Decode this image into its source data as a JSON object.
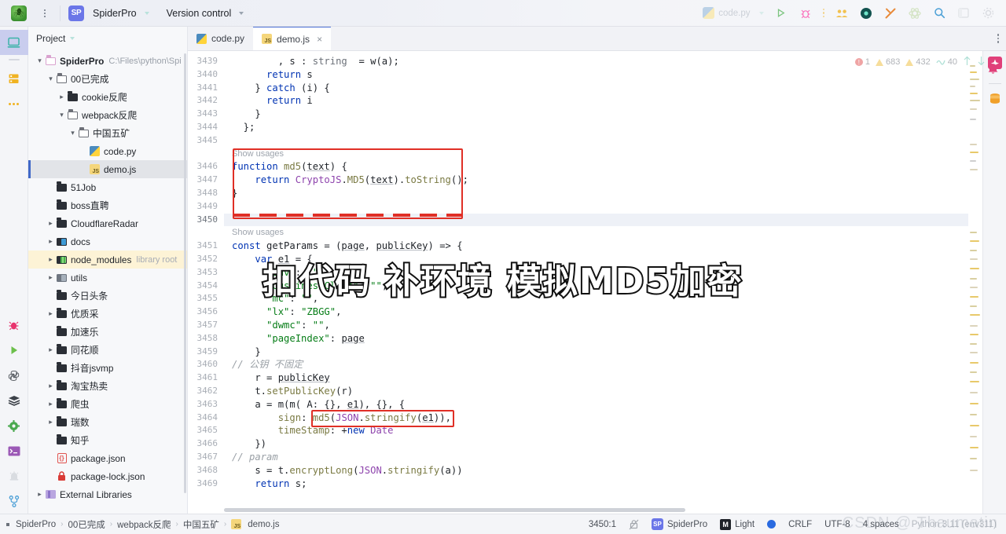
{
  "titlebar": {
    "app_logo_icon": "spider-logo-icon",
    "menu_icon": "main-menu-kebab-icon",
    "project_badge": "SP",
    "project_name": "SpiderPro",
    "vcs_label": "Version control",
    "run_config_label": "code.py",
    "icons": {
      "run": "run-icon",
      "debug": "debug-bug-icon",
      "more": "more-actions-kebab-icon",
      "collab": "code-with-me-icon",
      "ai": "ai-assistant-icon",
      "tools": "build-tools-icon",
      "atom": "science-atom-icon",
      "search": "search-everywhere-icon",
      "panel": "layout-panel-icon",
      "settings": "settings-gear-icon"
    }
  },
  "activitybar": {
    "items": [
      {
        "name": "project-tool-icon",
        "glyph": "monitor",
        "selected": true
      },
      {
        "name": "database-tool-icon",
        "glyph": "database",
        "selected": false
      },
      {
        "name": "more-tool-windows-icon",
        "glyph": "dots",
        "selected": false
      }
    ],
    "bottom_items": [
      {
        "name": "bug-tool-icon",
        "glyph": "bug"
      },
      {
        "name": "run-tool-icon",
        "glyph": "play"
      },
      {
        "name": "python-console-icon",
        "glyph": "python"
      },
      {
        "name": "services-stack-icon",
        "glyph": "stack"
      },
      {
        "name": "settings-gear-icon",
        "glyph": "gear"
      },
      {
        "name": "terminal-icon",
        "glyph": "terminal"
      },
      {
        "name": "problems-alert-icon",
        "glyph": "alert"
      },
      {
        "name": "version-control-branch-icon",
        "glyph": "branch"
      }
    ]
  },
  "project_panel": {
    "title": "Project",
    "tree": [
      {
        "indent": 0,
        "arrow": "down",
        "icon": "folder-pink",
        "label": "SpiderPro",
        "bold": true,
        "sub": "C:\\Files\\python\\Spi"
      },
      {
        "indent": 1,
        "arrow": "down",
        "icon": "folder-open",
        "label": "00已完成"
      },
      {
        "indent": 2,
        "arrow": "right",
        "icon": "folder-dark",
        "label": "cookie反爬"
      },
      {
        "indent": 2,
        "arrow": "down",
        "icon": "folder-open",
        "label": "webpack反爬"
      },
      {
        "indent": 3,
        "arrow": "down",
        "icon": "folder-open",
        "label": "中国五矿"
      },
      {
        "indent": 4,
        "arrow": "none",
        "icon": "python-file",
        "label": "code.py"
      },
      {
        "indent": 4,
        "arrow": "none",
        "icon": "js-file",
        "label": "demo.js",
        "selected": true
      },
      {
        "indent": 1,
        "arrow": "none",
        "icon": "folder-dark",
        "label": "51Job"
      },
      {
        "indent": 1,
        "arrow": "none",
        "icon": "folder-dark",
        "label": "boss直聘"
      },
      {
        "indent": 1,
        "arrow": "right",
        "icon": "folder-dark",
        "label": "CloudflareRadar"
      },
      {
        "indent": 1,
        "arrow": "right",
        "icon": "folder-blue",
        "label": "docs"
      },
      {
        "indent": 1,
        "arrow": "right",
        "icon": "folder-green",
        "label": "node_modules",
        "sub2": "library root",
        "highlight": true
      },
      {
        "indent": 1,
        "arrow": "right",
        "icon": "folder-grey",
        "label": "utils"
      },
      {
        "indent": 1,
        "arrow": "none",
        "icon": "folder-dark",
        "label": "今日头条"
      },
      {
        "indent": 1,
        "arrow": "right",
        "icon": "folder-dark",
        "label": "优质采"
      },
      {
        "indent": 1,
        "arrow": "none",
        "icon": "folder-dark",
        "label": "加速乐"
      },
      {
        "indent": 1,
        "arrow": "right",
        "icon": "folder-dark",
        "label": "同花顺"
      },
      {
        "indent": 1,
        "arrow": "none",
        "icon": "folder-dark",
        "label": "抖音jsvmp"
      },
      {
        "indent": 1,
        "arrow": "right",
        "icon": "folder-dark",
        "label": "淘宝热卖"
      },
      {
        "indent": 1,
        "arrow": "right",
        "icon": "folder-dark",
        "label": "爬虫"
      },
      {
        "indent": 1,
        "arrow": "right",
        "icon": "folder-dark",
        "label": "瑞数"
      },
      {
        "indent": 1,
        "arrow": "none",
        "icon": "folder-dark",
        "label": "知乎"
      },
      {
        "indent": 1,
        "arrow": "none",
        "icon": "json-file",
        "label": "package.json"
      },
      {
        "indent": 1,
        "arrow": "none",
        "icon": "lock-file",
        "label": "package-lock.json"
      },
      {
        "indent": 0,
        "arrow": "right",
        "icon": "folder-purple",
        "label": "External Libraries"
      }
    ]
  },
  "editor": {
    "tabs": [
      {
        "label": "code.py",
        "icon": "python-file-icon",
        "active": false,
        "closable": false
      },
      {
        "label": "demo.js",
        "icon": "js-file-icon",
        "active": true,
        "closable": true,
        "close_label": "×"
      }
    ],
    "tab_options_icon": "editor-options-kebab-icon",
    "inspection": {
      "errors": "1",
      "warnings": "683",
      "weak_warnings": "432",
      "typos": "40",
      "prev_icon": "previous-highlight-icon",
      "next_icon": "next-highlight-icon",
      "widget_icon": "inspections-widget-icon"
    },
    "first_line_number": 3439,
    "lines": [
      {
        "n": 3439,
        "code": ", s : string  = w(a);"
      },
      {
        "n": 3440,
        "code": "return s"
      },
      {
        "n": 3441,
        "code": "} catch (i) {"
      },
      {
        "n": 3442,
        "code": "return i"
      },
      {
        "n": 3443,
        "code": "}"
      },
      {
        "n": 3444,
        "code": "};"
      },
      {
        "n": 3445,
        "code": ""
      },
      {
        "n": 3446,
        "code": "function md5(text) {",
        "hint": "Show usages"
      },
      {
        "n": 3447,
        "code": "return CryptoJS.MD5(text).toString();"
      },
      {
        "n": 3448,
        "code": "}"
      },
      {
        "n": 3449,
        "code": ""
      },
      {
        "n": 3450,
        "code": "",
        "current": true
      },
      {
        "n": 3451,
        "code": "const getParams = (page, publicKey) => {",
        "hint": "Show usages"
      },
      {
        "n": 3452,
        "code": "var e1 = {"
      },
      {
        "n": 3453,
        "code": "\"inv\": \"\","
      },
      {
        "n": 3454,
        "code": "\"bussinessClass\": \"\","
      },
      {
        "n": 3455,
        "code": "\"mc\": \"\","
      },
      {
        "n": 3456,
        "code": "\"lx\": \"ZBGG\","
      },
      {
        "n": 3457,
        "code": "\"dwmc\": \"\","
      },
      {
        "n": 3458,
        "code": "\"pageIndex\": page"
      },
      {
        "n": 3459,
        "code": "}"
      },
      {
        "n": 3460,
        "code": "// 公钥 不固定"
      },
      {
        "n": 3461,
        "code": "r = publicKey"
      },
      {
        "n": 3462,
        "code": "t.setPublicKey(r)"
      },
      {
        "n": 3463,
        "code": "a = m(m( A: {}, e1), {}, {"
      },
      {
        "n": 3464,
        "code": "sign: md5(JSON.stringify(e1)),"
      },
      {
        "n": 3465,
        "code": "timeStamp: +new Date"
      },
      {
        "n": 3466,
        "code": "})"
      },
      {
        "n": 3467,
        "code": "// param"
      },
      {
        "n": 3468,
        "code": "s = t.encryptLong(JSON.stringify(a))"
      },
      {
        "n": 3469,
        "code": "return s;"
      }
    ],
    "right_tools": [
      {
        "name": "ai-assistant-panel-icon"
      },
      {
        "name": "database-panel-icon"
      }
    ],
    "notification_icon": "notifications-bell-icon"
  },
  "annotations": {
    "box1_label": "md5-function-highlight-box",
    "box2_label": "md5-sign-call-highlight-box",
    "accent_color": "#e02f26"
  },
  "overlay": {
    "subtitle": "扣代码  补环境  模拟MD5加密"
  },
  "statusbar": {
    "breadcrumbs": [
      "SpiderPro",
      "00已完成",
      "webpack反爬",
      "中国五矿",
      "demo.js"
    ],
    "separator": "›",
    "file_icon": "js-file-icon",
    "caret_position": "3450:1",
    "readonly_icon": "no-write-lock-icon",
    "project_badge": "SP",
    "project_name": "SpiderPro",
    "theme_badge": "M",
    "theme_name": "Light",
    "indicator_icon": "sync-status-dot",
    "line_separator": "CRLF",
    "encoding": "UTF-8",
    "indent": "4 spaces",
    "interpreter": "Python 3.11 (env311)",
    "watermark": "CSDN @ Thaumatin"
  }
}
